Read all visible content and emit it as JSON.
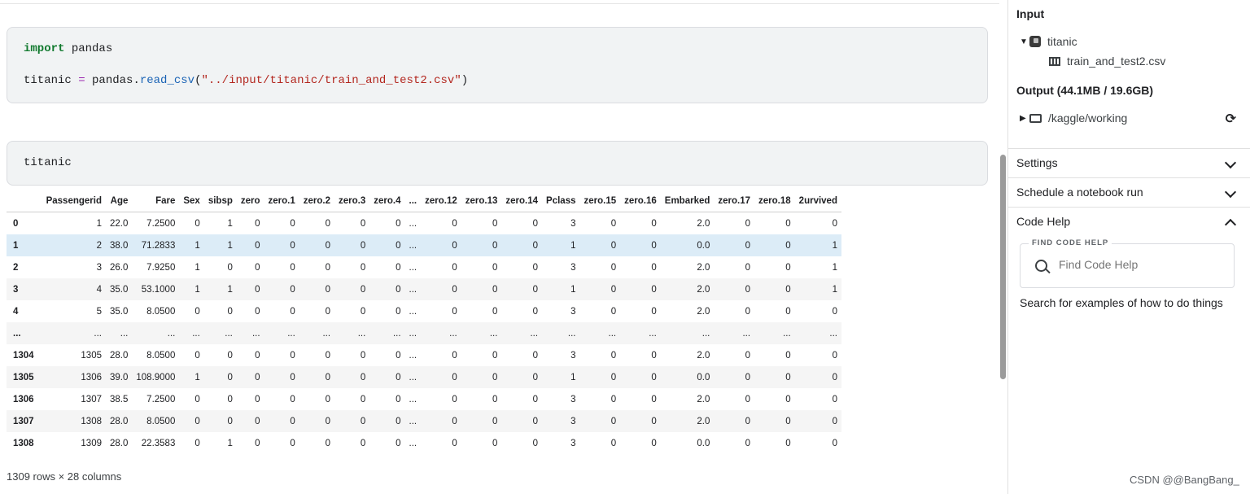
{
  "cells": {
    "cell1": {
      "import_kw": "import",
      "import_mod": "pandas",
      "var": "titanic",
      "eq": "=",
      "obj": "pandas.",
      "func": "read_csv",
      "paren_open": "(",
      "path": "\"../input/titanic/train_and_test2.csv\"",
      "paren_close": ")"
    },
    "cell2": {
      "code": "titanic"
    }
  },
  "dataframe": {
    "columns": [
      "Passengerid",
      "Age",
      "Fare",
      "Sex",
      "sibsp",
      "zero",
      "zero.1",
      "zero.2",
      "zero.3",
      "zero.4",
      "...",
      "zero.12",
      "zero.13",
      "zero.14",
      "Pclass",
      "zero.15",
      "zero.16",
      "Embarked",
      "zero.17",
      "zero.18",
      "2urvived"
    ],
    "rows": [
      {
        "index": "0",
        "values": [
          "1",
          "22.0",
          "7.2500",
          "0",
          "1",
          "0",
          "0",
          "0",
          "0",
          "0",
          "...",
          "0",
          "0",
          "0",
          "3",
          "0",
          "0",
          "2.0",
          "0",
          "0",
          "0"
        ]
      },
      {
        "index": "1",
        "values": [
          "2",
          "38.0",
          "71.2833",
          "1",
          "1",
          "0",
          "0",
          "0",
          "0",
          "0",
          "...",
          "0",
          "0",
          "0",
          "1",
          "0",
          "0",
          "0.0",
          "0",
          "0",
          "1"
        ],
        "highlight": true
      },
      {
        "index": "2",
        "values": [
          "3",
          "26.0",
          "7.9250",
          "1",
          "0",
          "0",
          "0",
          "0",
          "0",
          "0",
          "...",
          "0",
          "0",
          "0",
          "3",
          "0",
          "0",
          "2.0",
          "0",
          "0",
          "1"
        ]
      },
      {
        "index": "3",
        "values": [
          "4",
          "35.0",
          "53.1000",
          "1",
          "1",
          "0",
          "0",
          "0",
          "0",
          "0",
          "...",
          "0",
          "0",
          "0",
          "1",
          "0",
          "0",
          "2.0",
          "0",
          "0",
          "1"
        ]
      },
      {
        "index": "4",
        "values": [
          "5",
          "35.0",
          "8.0500",
          "0",
          "0",
          "0",
          "0",
          "0",
          "0",
          "0",
          "...",
          "0",
          "0",
          "0",
          "3",
          "0",
          "0",
          "2.0",
          "0",
          "0",
          "0"
        ]
      },
      {
        "index": "...",
        "values": [
          "...",
          "...",
          "...",
          "...",
          "...",
          "...",
          "...",
          "...",
          "...",
          "...",
          "...",
          "...",
          "...",
          "...",
          "...",
          "...",
          "...",
          "...",
          "...",
          "...",
          "..."
        ]
      },
      {
        "index": "1304",
        "values": [
          "1305",
          "28.0",
          "8.0500",
          "0",
          "0",
          "0",
          "0",
          "0",
          "0",
          "0",
          "...",
          "0",
          "0",
          "0",
          "3",
          "0",
          "0",
          "2.0",
          "0",
          "0",
          "0"
        ]
      },
      {
        "index": "1305",
        "values": [
          "1306",
          "39.0",
          "108.9000",
          "1",
          "0",
          "0",
          "0",
          "0",
          "0",
          "0",
          "...",
          "0",
          "0",
          "0",
          "1",
          "0",
          "0",
          "0.0",
          "0",
          "0",
          "0"
        ]
      },
      {
        "index": "1306",
        "values": [
          "1307",
          "38.5",
          "7.2500",
          "0",
          "0",
          "0",
          "0",
          "0",
          "0",
          "0",
          "...",
          "0",
          "0",
          "0",
          "3",
          "0",
          "0",
          "2.0",
          "0",
          "0",
          "0"
        ]
      },
      {
        "index": "1307",
        "values": [
          "1308",
          "28.0",
          "8.0500",
          "0",
          "0",
          "0",
          "0",
          "0",
          "0",
          "0",
          "...",
          "0",
          "0",
          "0",
          "3",
          "0",
          "0",
          "2.0",
          "0",
          "0",
          "0"
        ]
      },
      {
        "index": "1308",
        "values": [
          "1309",
          "28.0",
          "22.3583",
          "0",
          "1",
          "0",
          "0",
          "0",
          "0",
          "0",
          "...",
          "0",
          "0",
          "0",
          "3",
          "0",
          "0",
          "0.0",
          "0",
          "0",
          "0"
        ]
      }
    ],
    "shape_caption": "1309 rows × 28 columns"
  },
  "panel": {
    "input_title": "Input",
    "dataset_name": "titanic",
    "file_name": "train_and_test2.csv",
    "output_title": "Output (44.1MB / 19.6GB)",
    "output_dir": "/kaggle/working",
    "sections": {
      "settings": "Settings",
      "schedule": "Schedule a notebook run",
      "code_help": "Code Help"
    },
    "find_code_help_legend": "FIND CODE HELP",
    "find_code_help_placeholder": "Find Code Help",
    "search_hint": "Search for examples of how to do things"
  },
  "icons": {
    "dataset": "dataset-icon",
    "csv": "table-file-icon",
    "folder": "folder-icon",
    "refresh": "refresh-icon",
    "search": "search-icon"
  },
  "watermark": "CSDN @@BangBang_"
}
